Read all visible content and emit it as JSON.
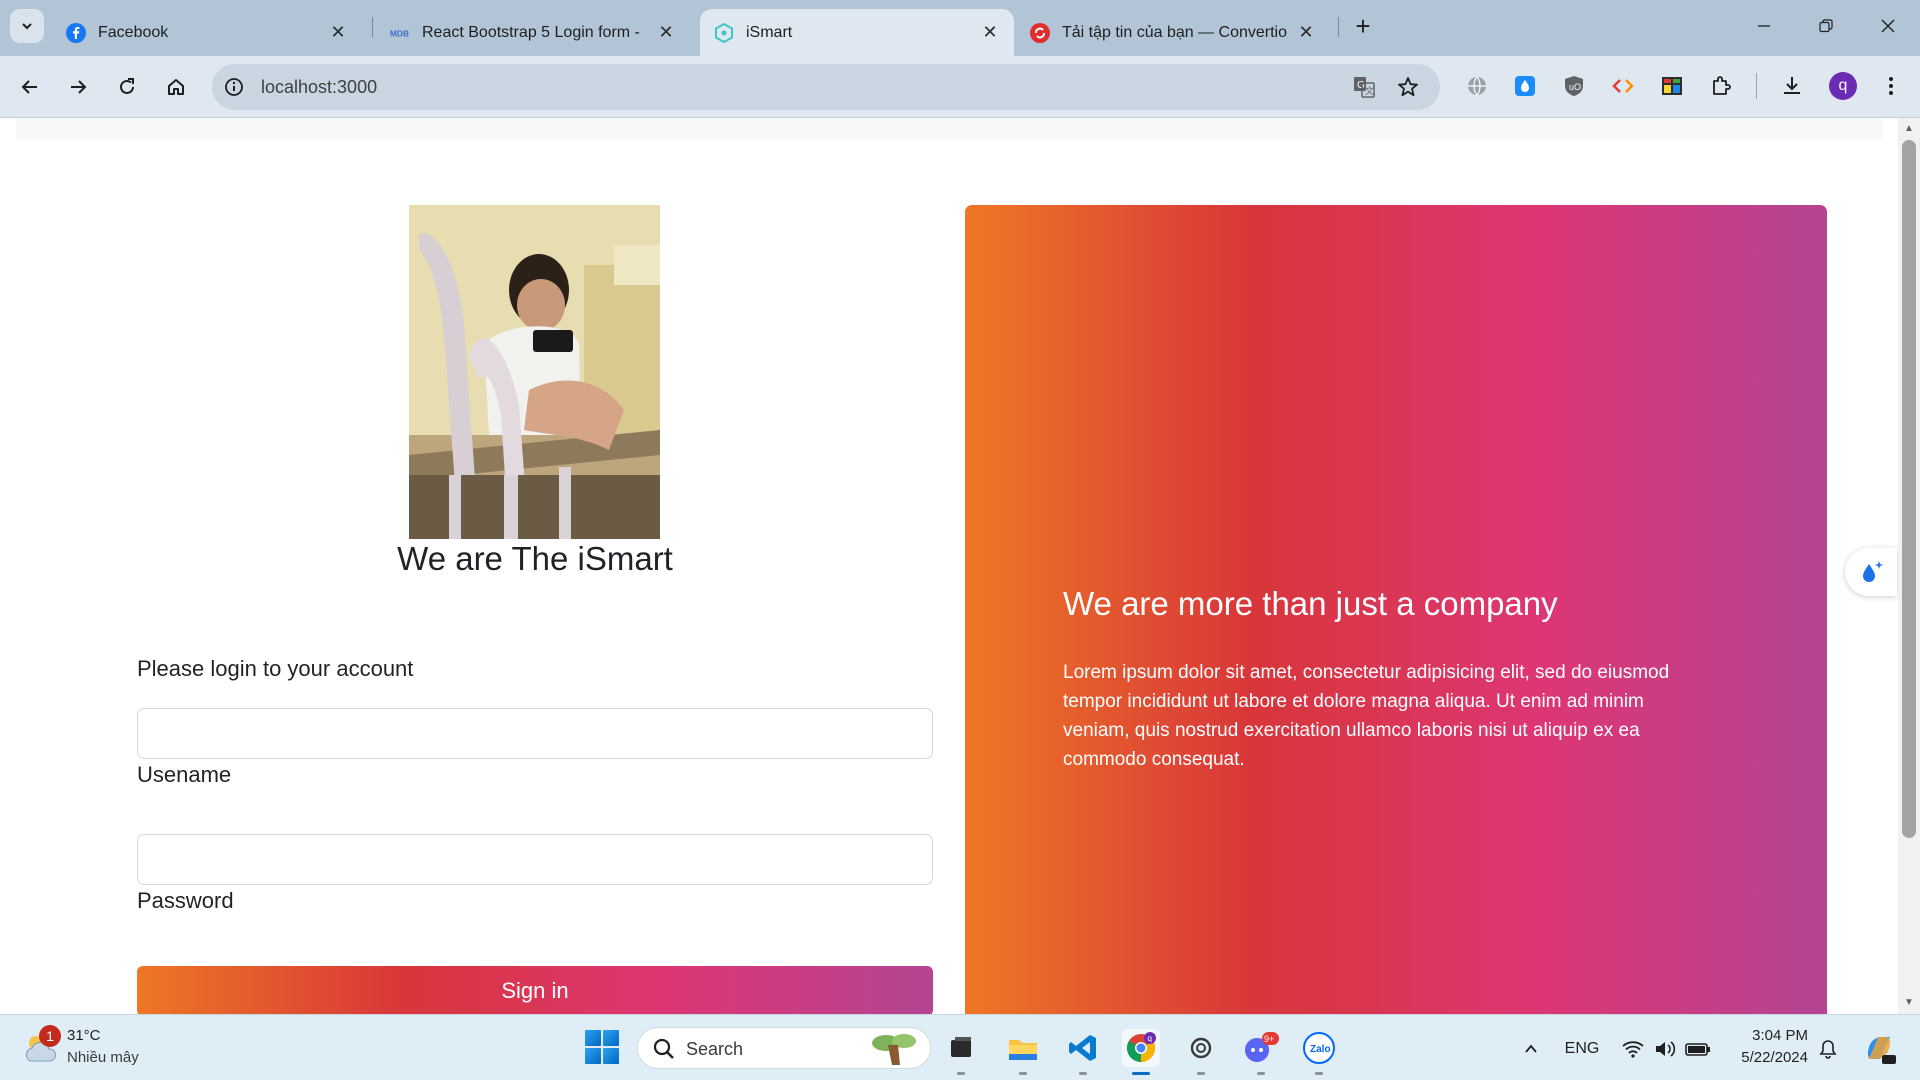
{
  "browser": {
    "tabs": [
      {
        "title": "Facebook",
        "favicon": "facebook-icon"
      },
      {
        "title": "React Bootstrap 5 Login form -",
        "favicon": "mdb-icon"
      },
      {
        "title": "iSmart",
        "favicon": "react-icon",
        "active": true
      },
      {
        "title": "Tải tập tin của bạn — Convertio",
        "favicon": "convertio-icon"
      }
    ],
    "url": "localhost:3000",
    "profile_initial": "q",
    "accent_color": "#dfe8f0"
  },
  "page": {
    "brand_title": "We are The iSmart",
    "login_prompt": "Please login to your account",
    "username_label": "Usename",
    "password_label": "Password",
    "username_value": "",
    "password_value": "",
    "signin_label": "Sign in",
    "promo_title": "We are more than just a company",
    "promo_body": "Lorem ipsum dolor sit amet, consectetur adipisicing elit, sed do eiusmod tempor incididunt ut labore et dolore magna aliqua. Ut enim ad minim veniam, quis nostrud exercitation ullamco laboris nisi ut aliquip ex ea commodo consequat.",
    "gradient_colors": [
      "#ee7724",
      "#d8363a",
      "#dd3675",
      "#b44593"
    ]
  },
  "taskbar": {
    "weather_temp": "31°C",
    "weather_desc": "Nhiều mây",
    "weather_badge": "1",
    "search_placeholder": "Search",
    "language": "ENG",
    "time": "3:04 PM",
    "date": "5/22/2024",
    "chrome_badge": "q",
    "discord_badge": "9+",
    "zalo_label": "Zalo"
  }
}
